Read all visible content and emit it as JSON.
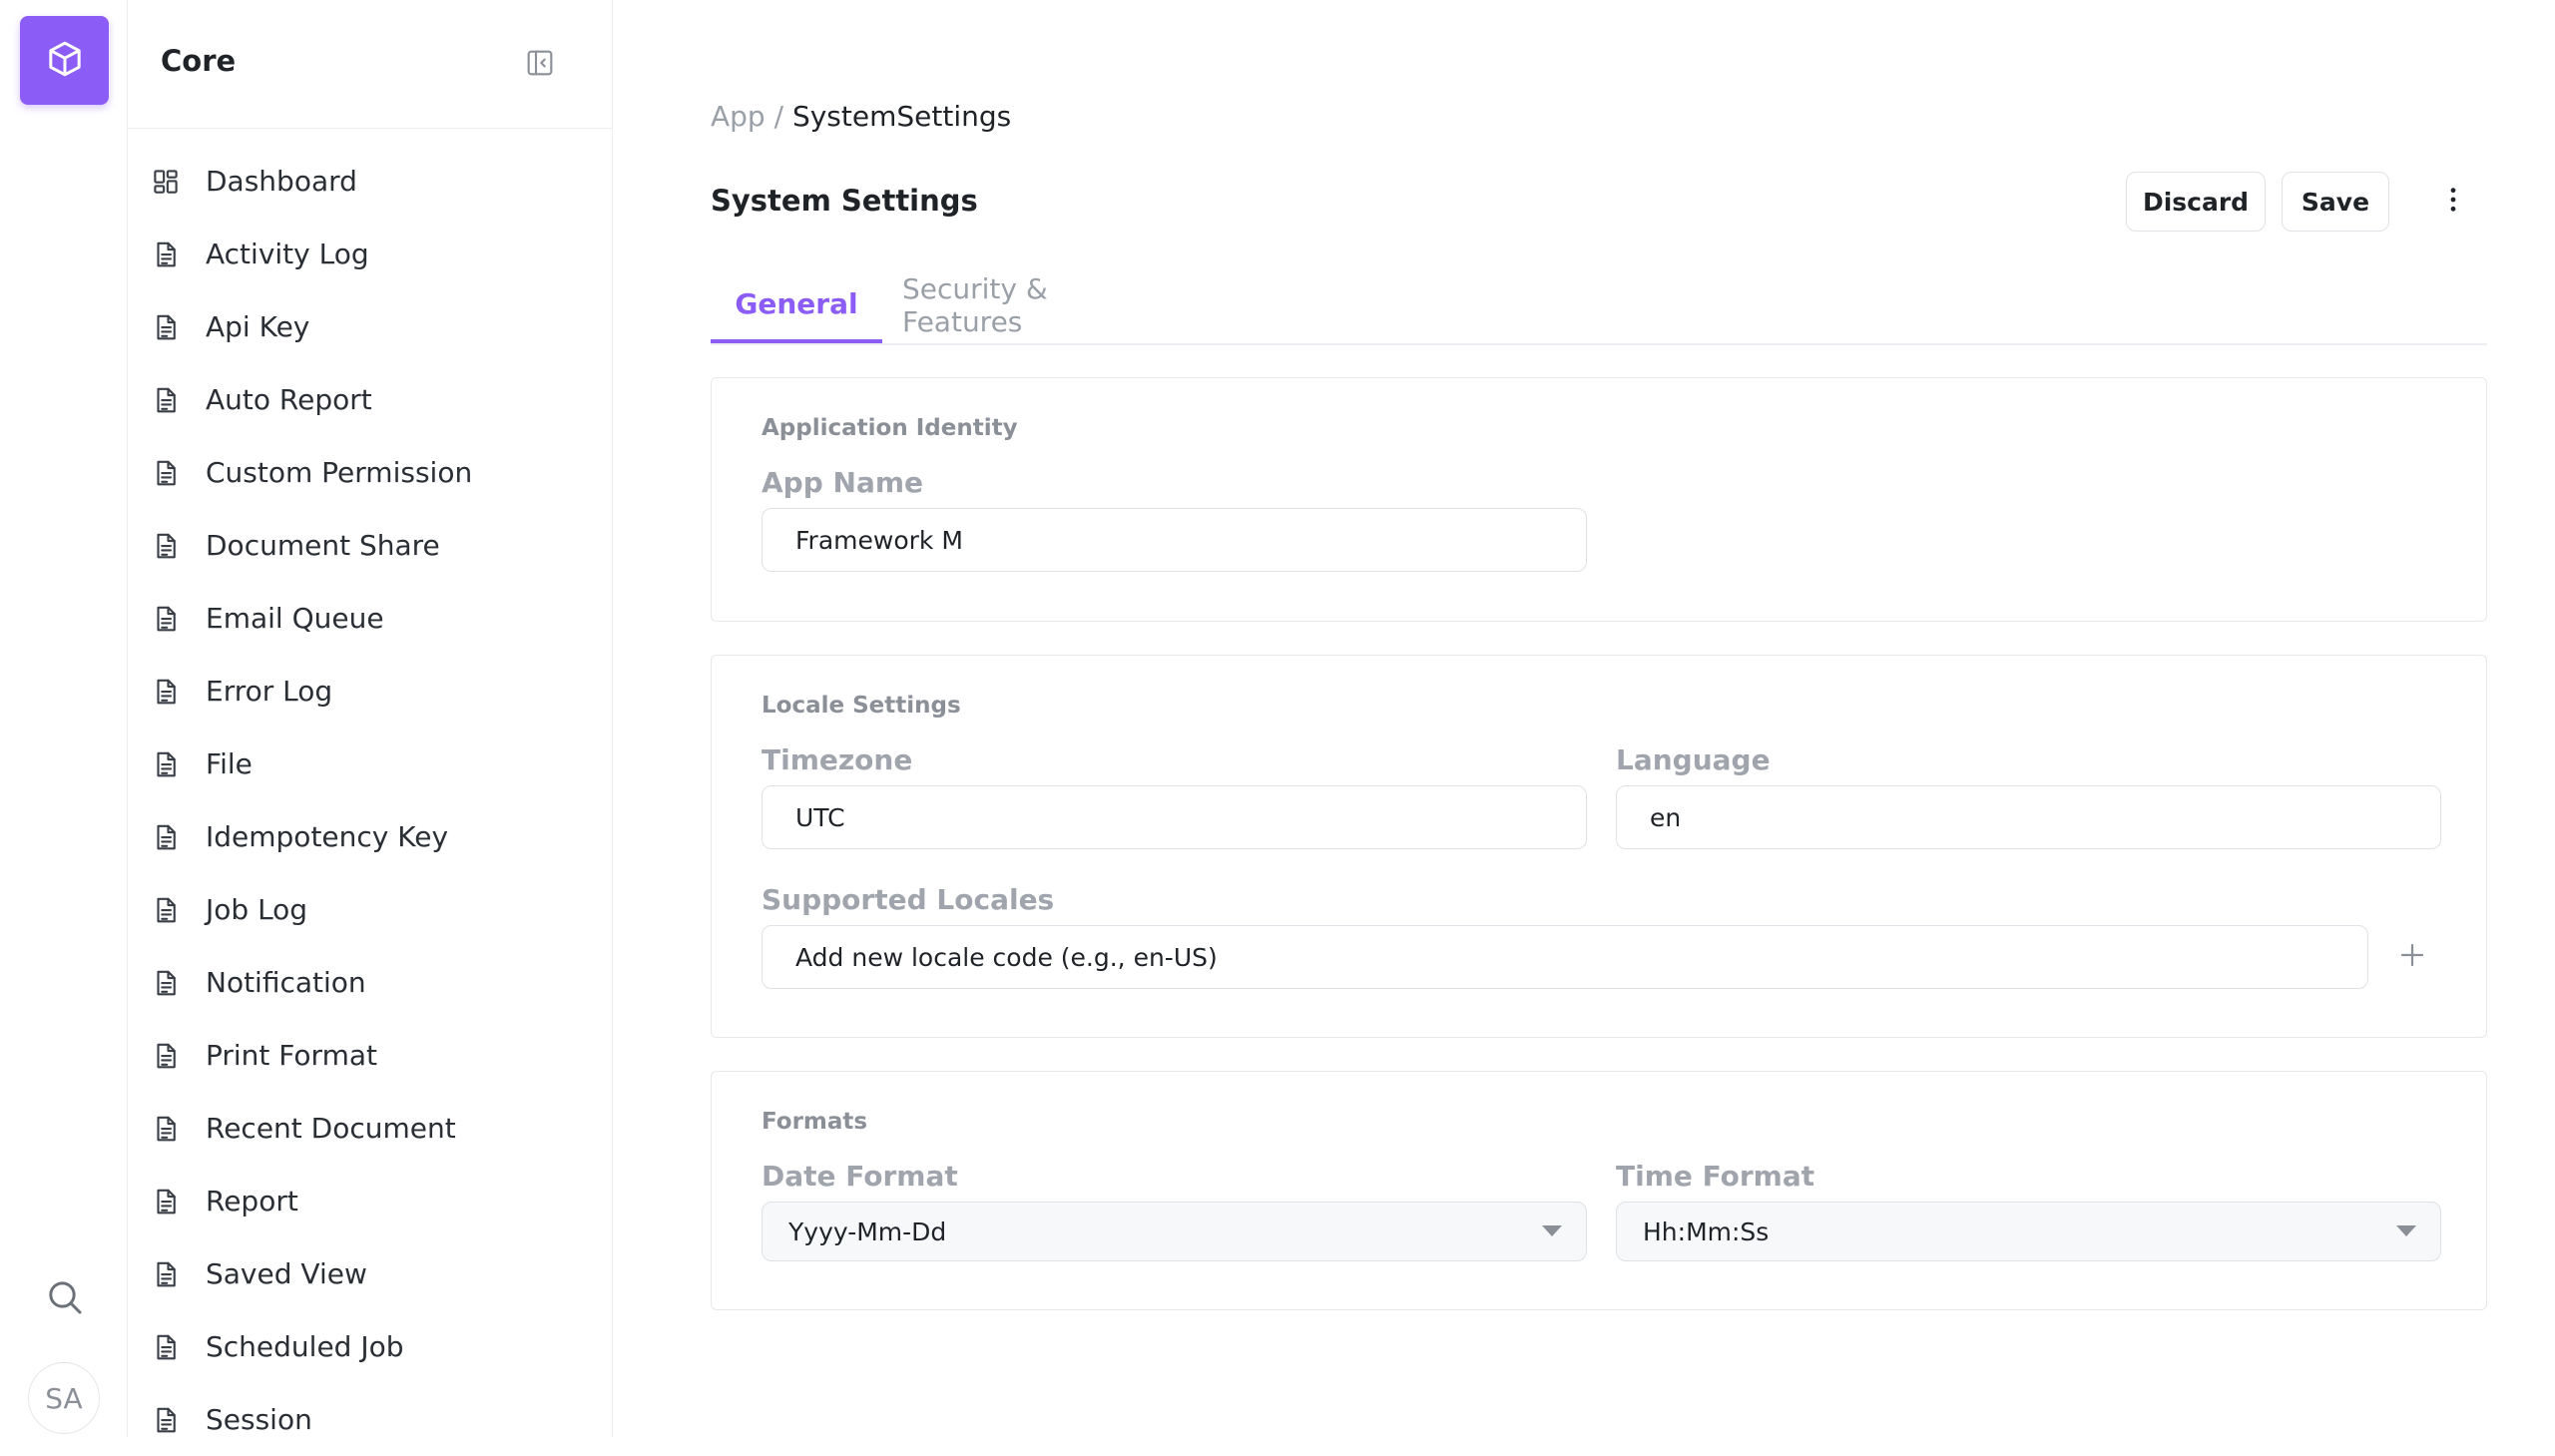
{
  "rail": {
    "logo_icon": "cube-icon",
    "search_icon": "search-icon",
    "avatar_initials": "SA"
  },
  "sidebar": {
    "title": "Core",
    "collapse_icon": "sidebar-collapse-icon",
    "items": [
      {
        "label": "Dashboard",
        "icon": "dashboard-icon"
      },
      {
        "label": "Activity Log",
        "icon": "document-icon"
      },
      {
        "label": "Api Key",
        "icon": "document-icon"
      },
      {
        "label": "Auto Report",
        "icon": "document-icon"
      },
      {
        "label": "Custom Permission",
        "icon": "document-icon"
      },
      {
        "label": "Document Share",
        "icon": "document-icon"
      },
      {
        "label": "Email Queue",
        "icon": "document-icon"
      },
      {
        "label": "Error Log",
        "icon": "document-icon"
      },
      {
        "label": "File",
        "icon": "document-icon"
      },
      {
        "label": "Idempotency Key",
        "icon": "document-icon"
      },
      {
        "label": "Job Log",
        "icon": "document-icon"
      },
      {
        "label": "Notification",
        "icon": "document-icon"
      },
      {
        "label": "Print Format",
        "icon": "document-icon"
      },
      {
        "label": "Recent Document",
        "icon": "document-icon"
      },
      {
        "label": "Report",
        "icon": "document-icon"
      },
      {
        "label": "Saved View",
        "icon": "document-icon"
      },
      {
        "label": "Scheduled Job",
        "icon": "document-icon"
      },
      {
        "label": "Session",
        "icon": "document-icon"
      }
    ]
  },
  "breadcrumb": {
    "root": "App",
    "separator": "/",
    "current": "SystemSettings"
  },
  "header": {
    "title": "System Settings",
    "discard_label": "Discard",
    "save_label": "Save",
    "more_icon": "more-vertical-icon"
  },
  "tabs": [
    {
      "label": "General",
      "active": true
    },
    {
      "label": "Security & Features",
      "active": false
    }
  ],
  "sections": {
    "identity": {
      "title": "Application Identity",
      "app_name_label": "App Name",
      "app_name_value": "Framework M"
    },
    "locale": {
      "title": "Locale Settings",
      "timezone_label": "Timezone",
      "timezone_value": "UTC",
      "language_label": "Language",
      "language_value": "en",
      "supported_locales_label": "Supported Locales",
      "supported_locales_placeholder": "Add new locale code (e.g., en-US)",
      "add_icon": "plus-icon"
    },
    "formats": {
      "title": "Formats",
      "date_format_label": "Date Format",
      "date_format_value": "Yyyy-Mm-Dd",
      "time_format_label": "Time Format",
      "time_format_value": "Hh:Mm:Ss"
    }
  },
  "colors": {
    "accent": "#8b5cf6",
    "border": "#e6e8eb",
    "muted_text": "#9aa0a8"
  }
}
